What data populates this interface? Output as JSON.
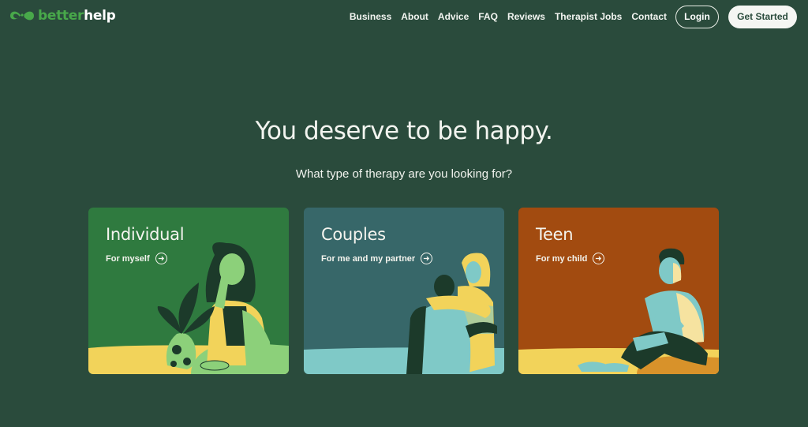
{
  "header": {
    "logo": {
      "part1": "better",
      "part2": "help",
      "icon": "betterhelp-logo-icon"
    },
    "nav": [
      {
        "label": "Business"
      },
      {
        "label": "About"
      },
      {
        "label": "Advice"
      },
      {
        "label": "FAQ"
      },
      {
        "label": "Reviews"
      },
      {
        "label": "Therapist Jobs"
      },
      {
        "label": "Contact"
      }
    ],
    "login_label": "Login",
    "get_started_label": "Get Started"
  },
  "hero": {
    "title": "You deserve to be happy.",
    "subtitle": "What type of therapy are you looking for?"
  },
  "cards": [
    {
      "title": "Individual",
      "subtitle": "For myself",
      "icon": "arrow-right-circle-icon",
      "color": "#2f7a3f"
    },
    {
      "title": "Couples",
      "subtitle": "For me and my partner",
      "icon": "arrow-right-circle-icon",
      "color": "#376769"
    },
    {
      "title": "Teen",
      "subtitle": "For my child",
      "icon": "arrow-right-circle-icon",
      "color": "#a24b10"
    }
  ],
  "colors": {
    "background": "#2a4b3c",
    "brand_green": "#48a84a",
    "accent_yellow": "#f2d35a"
  }
}
